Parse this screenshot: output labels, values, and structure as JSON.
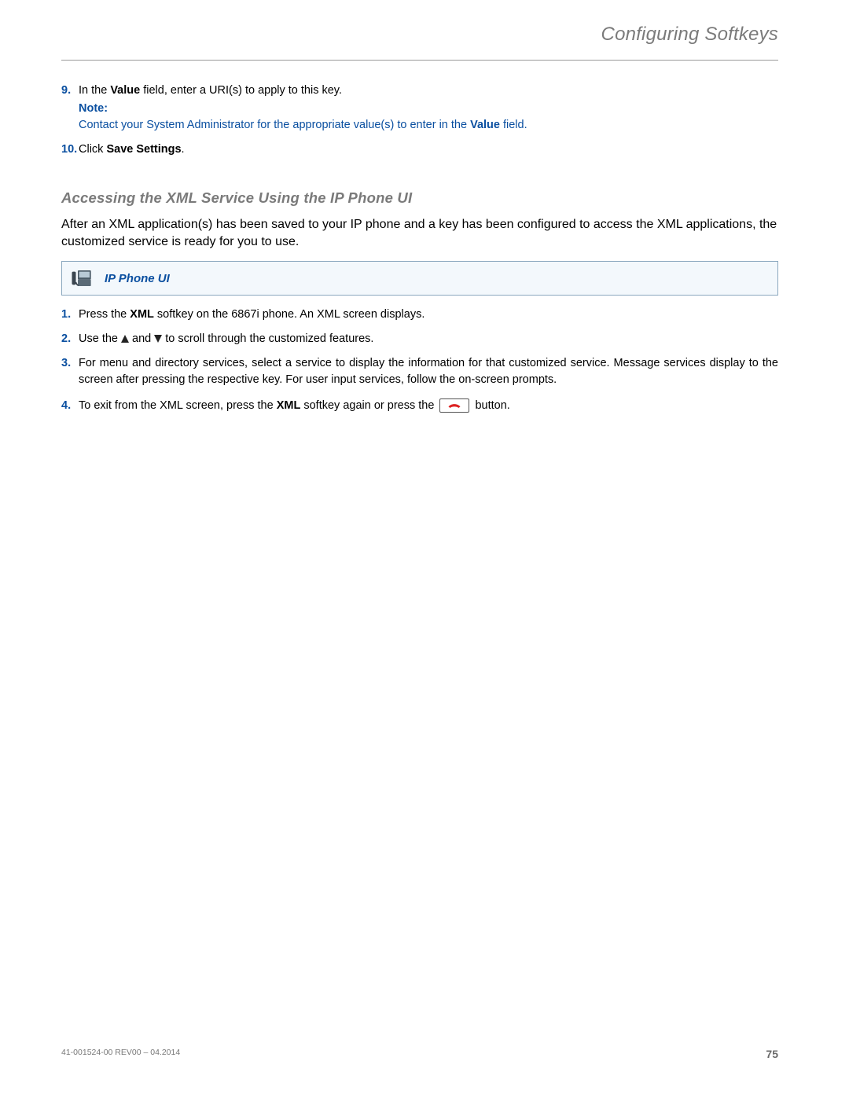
{
  "header": {
    "title": "Configuring Softkeys"
  },
  "steps_top": {
    "item9": {
      "num": "9.",
      "prefix": "In the ",
      "bold1": "Value",
      "mid": " field, enter a URI(s) to apply to this key.",
      "note_label": "Note:",
      "note_body_a": "Contact your System Administrator for the appropriate value(s) to enter in the ",
      "note_bold": "Value",
      "note_body_b": " field."
    },
    "item10": {
      "num": "10.",
      "prefix": "Click ",
      "bold1": "Save Settings",
      "suffix": "."
    }
  },
  "subheading": "Accessing the XML Service Using the IP Phone UI",
  "intro": "After an XML application(s) has been saved to your IP phone and a key has been configured to access the XML applications, the customized service is ready for you to use.",
  "ui_box": {
    "label": "IP Phone UI"
  },
  "steps_bottom": {
    "item1": {
      "num": "1.",
      "a": "Press the ",
      "bold": "XML",
      "b": " softkey on the 6867i phone. An XML screen displays."
    },
    "item2": {
      "num": "2.",
      "a": "Use the ",
      "b": " and ",
      "c": " to scroll through the customized features."
    },
    "item3": {
      "num": "3.",
      "text": "For menu and directory services, select a service to display the information for that customized service. Message services display to the screen after pressing the respective key. For user input services, follow the on-screen prompts."
    },
    "item4": {
      "num": "4.",
      "a": "To exit from the XML screen, press the ",
      "bold": "XML",
      "b": " softkey again or press the ",
      "c": " button."
    }
  },
  "footer": {
    "left": "41-001524-00 REV00 – 04.2014",
    "right": "75"
  }
}
